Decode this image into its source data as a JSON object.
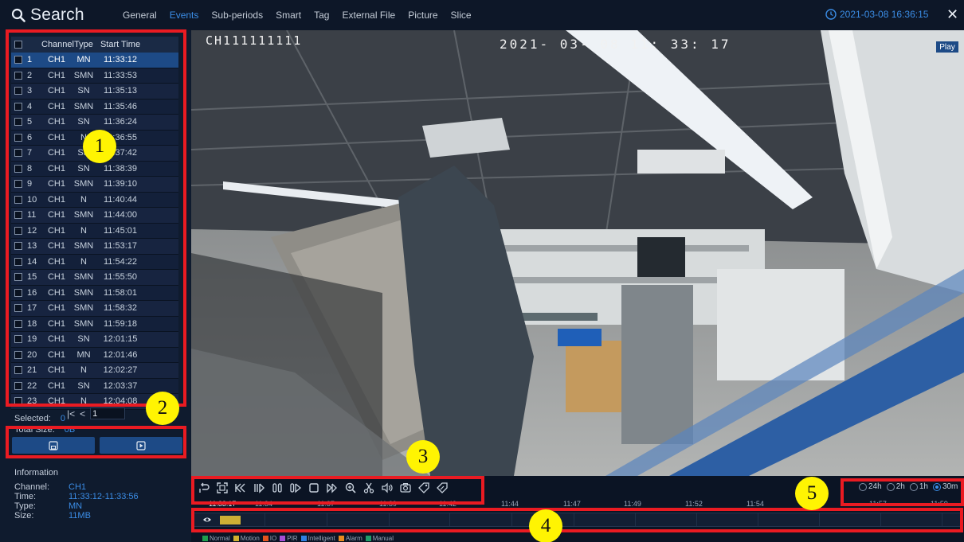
{
  "header": {
    "title": "Search",
    "tabs": [
      {
        "label": "General",
        "active": false
      },
      {
        "label": "Events",
        "active": true
      },
      {
        "label": "Sub-periods",
        "active": false
      },
      {
        "label": "Smart",
        "active": false
      },
      {
        "label": "Tag",
        "active": false
      },
      {
        "label": "External File",
        "active": false
      },
      {
        "label": "Picture",
        "active": false
      },
      {
        "label": "Slice",
        "active": false
      }
    ],
    "datetime": "2021-03-08 16:36:15",
    "close_label": "✕"
  },
  "event_list": {
    "columns": {
      "channel": "Channel",
      "type": "Type",
      "start_time": "Start Time"
    },
    "rows": [
      {
        "no": "1",
        "channel": "CH1",
        "type": "MN",
        "start": "11:33:12"
      },
      {
        "no": "2",
        "channel": "CH1",
        "type": "SMN",
        "start": "11:33:53"
      },
      {
        "no": "3",
        "channel": "CH1",
        "type": "SN",
        "start": "11:35:13"
      },
      {
        "no": "4",
        "channel": "CH1",
        "type": "SMN",
        "start": "11:35:46"
      },
      {
        "no": "5",
        "channel": "CH1",
        "type": "SN",
        "start": "11:36:24"
      },
      {
        "no": "6",
        "channel": "CH1",
        "type": "N",
        "start": "11:36:55"
      },
      {
        "no": "7",
        "channel": "CH1",
        "type": "SN",
        "start": "11:37:42"
      },
      {
        "no": "8",
        "channel": "CH1",
        "type": "SN",
        "start": "11:38:39"
      },
      {
        "no": "9",
        "channel": "CH1",
        "type": "SMN",
        "start": "11:39:10"
      },
      {
        "no": "10",
        "channel": "CH1",
        "type": "N",
        "start": "11:40:44"
      },
      {
        "no": "11",
        "channel": "CH1",
        "type": "SMN",
        "start": "11:44:00"
      },
      {
        "no": "12",
        "channel": "CH1",
        "type": "N",
        "start": "11:45:01"
      },
      {
        "no": "13",
        "channel": "CH1",
        "type": "SMN",
        "start": "11:53:17"
      },
      {
        "no": "14",
        "channel": "CH1",
        "type": "N",
        "start": "11:54:22"
      },
      {
        "no": "15",
        "channel": "CH1",
        "type": "SMN",
        "start": "11:55:50"
      },
      {
        "no": "16",
        "channel": "CH1",
        "type": "SMN",
        "start": "11:58:01"
      },
      {
        "no": "17",
        "channel": "CH1",
        "type": "SMN",
        "start": "11:58:32"
      },
      {
        "no": "18",
        "channel": "CH1",
        "type": "SMN",
        "start": "11:59:18"
      },
      {
        "no": "19",
        "channel": "CH1",
        "type": "SN",
        "start": "12:01:15"
      },
      {
        "no": "20",
        "channel": "CH1",
        "type": "MN",
        "start": "12:01:46"
      },
      {
        "no": "21",
        "channel": "CH1",
        "type": "N",
        "start": "12:02:27"
      },
      {
        "no": "22",
        "channel": "CH1",
        "type": "SN",
        "start": "12:03:37"
      },
      {
        "no": "23",
        "channel": "CH1",
        "type": "N",
        "start": "12:04:08"
      }
    ],
    "selected_row": 0,
    "pager": {
      "first": "|<",
      "prev": "<",
      "page": "1"
    }
  },
  "selection": {
    "selected_label": "Selected:",
    "selected_value": "0",
    "total_label": "Total Size:",
    "total_value": "0B"
  },
  "actions": {
    "save_icon": "floppy-icon",
    "play_icon": "play-square-icon"
  },
  "information": {
    "title": "Information",
    "items": [
      {
        "k": "Channel:",
        "v": "CH1"
      },
      {
        "k": "Time:",
        "v": "11:33:12-11:33:56"
      },
      {
        "k": "Type:",
        "v": "MN"
      },
      {
        "k": "Size:",
        "v": "11MB"
      }
    ]
  },
  "video": {
    "osd_channel": "CH111111111",
    "osd_timestamp": "2021- 03- 08  11: 33: 17",
    "play_badge": "Play"
  },
  "timeline": {
    "ranges": [
      {
        "label": "24h",
        "on": false
      },
      {
        "label": "2h",
        "on": false
      },
      {
        "label": "1h",
        "on": false
      },
      {
        "label": "30m",
        "on": true
      }
    ],
    "ticks": [
      "11:33:17",
      "11:34",
      "11:37",
      "11:39",
      "11:42",
      "11:44",
      "11:47",
      "11:49",
      "11:52",
      "11:54",
      "11:57",
      "11:59"
    ],
    "legend": [
      {
        "label": "Normal",
        "color": "#1f9d4d"
      },
      {
        "label": "Motion",
        "color": "#d1b12f"
      },
      {
        "label": "IO",
        "color": "#e5541e"
      },
      {
        "label": "PIR",
        "color": "#a64fd6"
      },
      {
        "label": "Intelligent",
        "color": "#2f7fe0"
      },
      {
        "label": "Alarm",
        "color": "#e88a1f"
      },
      {
        "label": "Manual",
        "color": "#1f9d6a"
      }
    ]
  },
  "annotations": [
    "1",
    "2",
    "3",
    "4",
    "5"
  ]
}
